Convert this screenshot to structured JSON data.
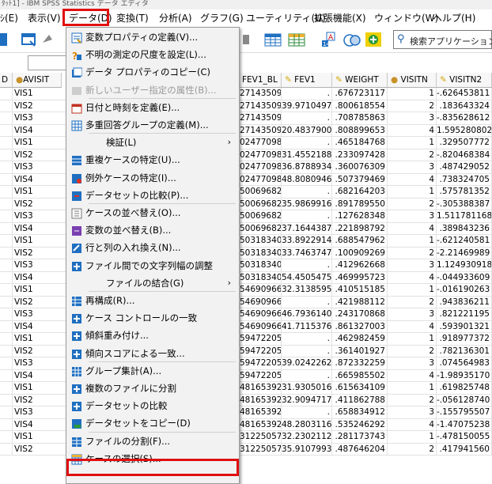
{
  "window": {
    "title": "ﾀｯﾄ1] - IBM SPSS Statistics データ エディタ"
  },
  "menubar": {
    "items": [
      "ｼ(E)",
      "表示(V)",
      "データ(D)",
      "変換(T)",
      "分析(A)",
      "グラフ(G)",
      "ユーティリティ(U)",
      "拡張機能(X)",
      "ウィンドウ(W)",
      "ヘルプ(H)"
    ]
  },
  "search": {
    "placeholder": "検索アプリケーション"
  },
  "columns": [
    "D",
    "AVISIT",
    "FEV1_BL",
    "FEV1",
    "WEIGHT",
    "VISITN",
    "VISITN2"
  ],
  "rows": [
    [
      "VIS1",
      "27143509",
      ".",
      ".676723117",
      "1",
      "-.626453811"
    ],
    [
      "VIS2",
      "27143509",
      "39.97104977",
      ".800618554",
      "2",
      ".183643324"
    ],
    [
      "VIS3",
      "27143509",
      ".",
      ".708785863",
      "3",
      "-.835628612"
    ],
    [
      "VIS4",
      "27143509",
      "20.48379000",
      ".808899653",
      "4",
      "1.595280802"
    ],
    [
      "VIS1",
      "02477098",
      ".",
      ".465184768",
      "1",
      ".329507772"
    ],
    [
      "VIS2",
      "02477098",
      "31.45521886",
      ".233097428",
      "2",
      "-.820468384"
    ],
    [
      "VIS3",
      "02477098",
      "36.87889346",
      ".360076309",
      "3",
      ".487429052"
    ],
    [
      "VIS4",
      "02477098",
      "48.80809465",
      ".507379469",
      "4",
      ".738324705"
    ],
    [
      "VIS1",
      "50069682",
      ".",
      ".682164203",
      "1",
      ".575781352"
    ],
    [
      "VIS2",
      "50069682",
      "35.98699164",
      ".891789550",
      "2",
      "-.305388387"
    ],
    [
      "VIS3",
      "50069682",
      ".",
      ".127628348",
      "3",
      "1.511781168"
    ],
    [
      "VIS4",
      "50069682",
      "37.16443872",
      ".221898792",
      "4",
      ".389843236"
    ],
    [
      "VIS1",
      "50318340",
      "33.89229144",
      ".688547962",
      "1",
      "-.621240581"
    ],
    [
      "VIS2",
      "50318340",
      "33.74637476",
      ".100909269",
      "2",
      "-2.21469989"
    ],
    [
      "VIS3",
      "50318340",
      ".",
      ".412962668",
      "3",
      "1.124930918"
    ],
    [
      "VIS4",
      "50318340",
      "54.45054753",
      ".469995723",
      "4",
      "-.044933609"
    ],
    [
      "VIS1",
      "54690966",
      "32.31385955",
      ".410515185",
      "1",
      "-.016190263"
    ],
    [
      "VIS2",
      "54690966",
      ".",
      ".421988112",
      "2",
      ".943836211"
    ],
    [
      "VIS3",
      "54690966",
      "46.79361406",
      ".243170868",
      "3",
      ".821221195"
    ],
    [
      "VIS4",
      "54690966",
      "41.71153761",
      ".861327003",
      "4",
      ".593901321"
    ],
    [
      "VIS1",
      "59472205",
      ".",
      ".462982459",
      "1",
      ".918977372"
    ],
    [
      "VIS2",
      "59472205",
      ".",
      ".361401927",
      "2",
      ".782136301"
    ],
    [
      "VIS3",
      "59472205",
      "39.02422621",
      ".872332259",
      "3",
      ".074564983"
    ],
    [
      "VIS4",
      "59472205",
      ".",
      ".665985502",
      "4",
      "-1.98935170"
    ],
    [
      "VIS1",
      "48165392",
      "31.93050164",
      ".615634109",
      "1",
      ".619825748"
    ],
    [
      "VIS2",
      "48165392",
      "32.90947172",
      ".411862788",
      "2",
      "-.056128740"
    ],
    [
      "VIS3",
      "48165392",
      ".",
      ".658834912",
      "3",
      "-.155795507"
    ],
    [
      "VIS4",
      "48165392",
      "48.28031161",
      ".535246292",
      "4",
      "-1.47075238"
    ],
    [
      "VIS1",
      "31225057",
      "32.23021121",
      ".281173743",
      "1",
      "-.478150055"
    ],
    [
      "VIS2",
      "31225057",
      "35.91079930",
      ".487646204",
      "2",
      ".417941560"
    ]
  ],
  "data_menu": {
    "items": [
      {
        "label": "変数プロパティの定義(V)...",
        "icon": "variable-properties-icon",
        "disabled": false,
        "submenu": false
      },
      {
        "label": "不明の測定の尺度を設定(L)...",
        "icon": "unknown-measure-icon",
        "disabled": false,
        "submenu": false
      },
      {
        "label": "データ プロパティのコピー(C)",
        "icon": "copy-properties-icon",
        "disabled": false,
        "submenu": false
      },
      {
        "label": "新しいユーザー指定の属性(B)...",
        "icon": "custom-attribute-icon",
        "disabled": true,
        "submenu": false
      },
      {
        "label": "日付と時刻を定義(E)...",
        "icon": "calendar-icon",
        "disabled": false,
        "submenu": false
      },
      {
        "label": "多重回答グループの定義(M)...",
        "icon": "multiple-response-icon",
        "disabled": false,
        "submenu": false
      },
      {
        "label": "検証(L)",
        "icon": "",
        "disabled": false,
        "submenu": true
      },
      {
        "label": "重複ケースの特定(U)...",
        "icon": "duplicate-cases-icon",
        "disabled": false,
        "submenu": false
      },
      {
        "label": "例外ケースの特定(I)...",
        "icon": "unusual-cases-icon",
        "disabled": false,
        "submenu": false
      },
      {
        "label": "データセットの比較(P)...",
        "icon": "compare-datasets-icon",
        "disabled": false,
        "submenu": false
      },
      {
        "label": "ケースの並べ替え(O)...",
        "icon": "sort-cases-icon",
        "disabled": false,
        "submenu": false
      },
      {
        "label": "変数の並べ替え(B)...",
        "icon": "sort-variables-icon",
        "disabled": false,
        "submenu": false
      },
      {
        "label": "行と列の入れ換え(N)...",
        "icon": "transpose-icon",
        "disabled": false,
        "submenu": false
      },
      {
        "label": "ファイル間での文字列幅の調整",
        "icon": "string-width-icon",
        "disabled": false,
        "submenu": false
      },
      {
        "label": "ファイルの結合(G)",
        "icon": "",
        "disabled": false,
        "submenu": true
      },
      {
        "label": "再構成(R)...",
        "icon": "restructure-icon",
        "disabled": false,
        "submenu": false
      },
      {
        "label": "ケース コントロールの一致",
        "icon": "case-control-icon",
        "disabled": false,
        "submenu": false
      },
      {
        "label": "傾斜重み付け...",
        "icon": "rake-weights-icon",
        "disabled": false,
        "submenu": false
      },
      {
        "label": "傾向スコアによる一致...",
        "icon": "propensity-icon",
        "disabled": false,
        "submenu": false
      },
      {
        "label": "グループ集計(A)...",
        "icon": "aggregate-icon",
        "disabled": false,
        "submenu": false
      },
      {
        "label": "複数のファイルに分割",
        "icon": "split-files-icon",
        "disabled": false,
        "submenu": false
      },
      {
        "label": "データセットの比較",
        "icon": "compare-icon",
        "disabled": false,
        "submenu": false
      },
      {
        "label": "データセットをコピー(D)",
        "icon": "copy-dataset-icon",
        "disabled": false,
        "submenu": false
      },
      {
        "label": "ファイルの分割(F)...",
        "icon": "split-file-icon",
        "disabled": false,
        "submenu": false
      },
      {
        "label": "ケースの選択(S)...",
        "icon": "select-cases-icon",
        "disabled": false,
        "submenu": false
      }
    ]
  },
  "colors": {
    "highlight": "#e01010",
    "menu_bg": "#f2f2f2",
    "icon_blue": "#1f6fc1"
  }
}
